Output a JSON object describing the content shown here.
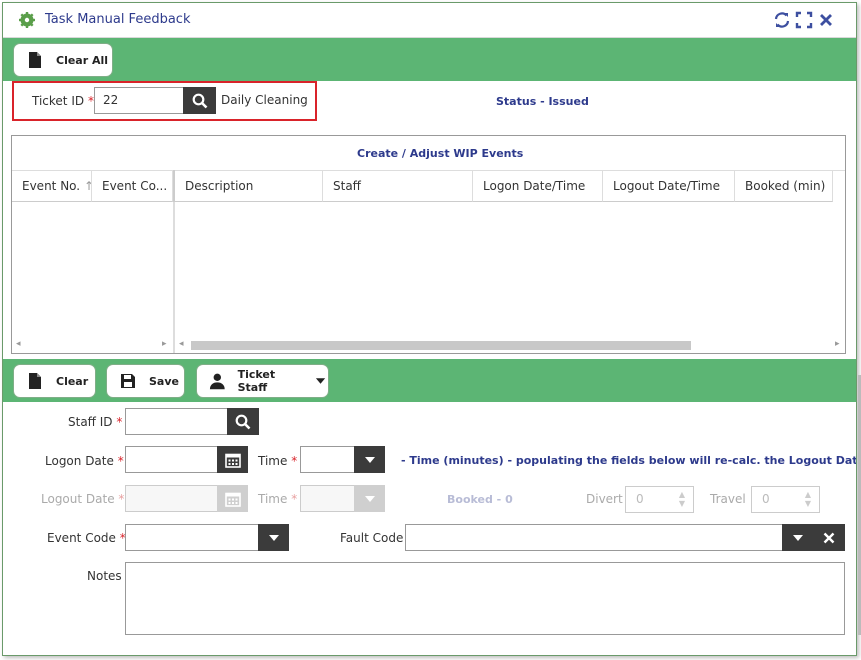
{
  "window": {
    "title": "Task Manual Feedback"
  },
  "toolbar_top": {
    "clear_all_label": "Clear All"
  },
  "ticket": {
    "id_label": "Ticket ID",
    "required_mark": "*",
    "id_value": "22",
    "description": "Daily Cleaning",
    "status_text": "Status -  Issued"
  },
  "grid": {
    "caption": "Create / Adjust WIP Events",
    "columns": [
      "Event No.",
      "Event Co...",
      "Description",
      "Staff",
      "Logon Date/Time",
      "Logout Date/Time",
      "Booked (min)"
    ],
    "rows": []
  },
  "toolbar_bottom": {
    "clear_label": "Clear",
    "save_label": "Save",
    "ticket_staff_label": "Ticket Staff"
  },
  "form": {
    "staff_id_label": "Staff ID",
    "logon_date_label": "Logon Date",
    "time_label": "Time",
    "time_hint": "- Time (minutes) - populating the fields below will re-calc. the Logout Date",
    "logout_date_label": "Logout Date",
    "logout_time_label": "Time",
    "booked_text": "Booked -  0",
    "divert_label": "Divert",
    "divert_value": "0",
    "travel_label": "Travel",
    "travel_value": "0",
    "event_code_label": "Event Code",
    "fault_code_label": "Fault Code",
    "notes_label": "Notes",
    "required_mark": "*"
  },
  "icons": {
    "app": "gear-icon",
    "refresh": "refresh-icon",
    "maximize": "maximize-icon",
    "close": "close-icon",
    "search": "search-icon",
    "calendar": "calendar-icon",
    "document": "document-icon",
    "save": "floppy-icon",
    "user": "user-icon",
    "chevron": "chevron-down-icon"
  },
  "colors": {
    "accent_green": "#5cb574",
    "title_blue": "#2d3a8c",
    "required_red": "#d9232a",
    "highlight_red": "#d9232a"
  }
}
